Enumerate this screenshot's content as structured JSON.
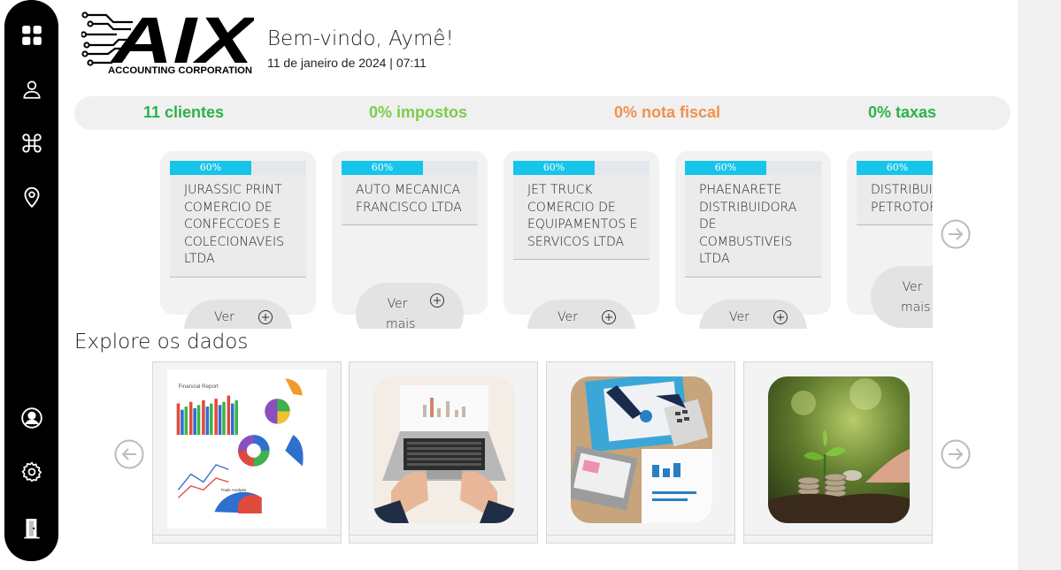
{
  "header": {
    "logo_main": "AIX",
    "logo_sub": "ACCOUNTING CORPORATION",
    "welcome": "Bem-vindo, Aymê!",
    "datetime": "11 de janeiro de 2024 | 07:11"
  },
  "sidebar": {
    "items": [
      {
        "icon": "dashboard-grid-icon"
      },
      {
        "icon": "user-icon"
      },
      {
        "icon": "command-icon"
      },
      {
        "icon": "location-pin-icon"
      },
      {
        "icon": "account-circle-icon"
      },
      {
        "icon": "gear-icon"
      },
      {
        "icon": "exit-door-icon"
      }
    ]
  },
  "stats": {
    "clients": "11 clientes",
    "taxes": "0% impostos",
    "invoice": "0% nota fiscal",
    "fees": "0% taxas",
    "colors": {
      "clients": "#2bb24c",
      "taxes": "#7dcb4d",
      "invoice": "#f0914e",
      "fees": "#2bb24c"
    }
  },
  "clients": [
    {
      "progress_pct": 60,
      "progress_label": "60%",
      "name": "JURASSIC PRINT COMERCIO DE CONFECCOES E COLECIONAVEIS LTDA",
      "button_label": "Ver"
    },
    {
      "progress_pct": 60,
      "progress_label": "60%",
      "name": "AUTO MECANICA FRANCISCO LTDA",
      "button_label": "Ver mais"
    },
    {
      "progress_pct": 60,
      "progress_label": "60%",
      "name": "JET TRUCK COMERCIO DE EQUIPAMENTOS E SERVICOS LTDA",
      "button_label": "Ver"
    },
    {
      "progress_pct": 60,
      "progress_label": "60%",
      "name": "PHAENARETE DISTRIBUIDORA DE COMBUSTIVEIS LTDA",
      "button_label": "Ver"
    },
    {
      "progress_pct": 60,
      "progress_label": "60%",
      "name": "DISTRIBUIDORA PETROTORRE JC",
      "button_label": "Ver mais"
    }
  ],
  "explore": {
    "title": "Explore os dados",
    "cards": [
      {
        "image": "financial-report-charts",
        "caption_title": "Financial Report",
        "caption_sub": "Trade Analysis"
      },
      {
        "image": "laptop-typing"
      },
      {
        "image": "desk-documents-calculator"
      },
      {
        "image": "coins-plant-growth"
      }
    ]
  },
  "accent_color": "#17c5ea"
}
